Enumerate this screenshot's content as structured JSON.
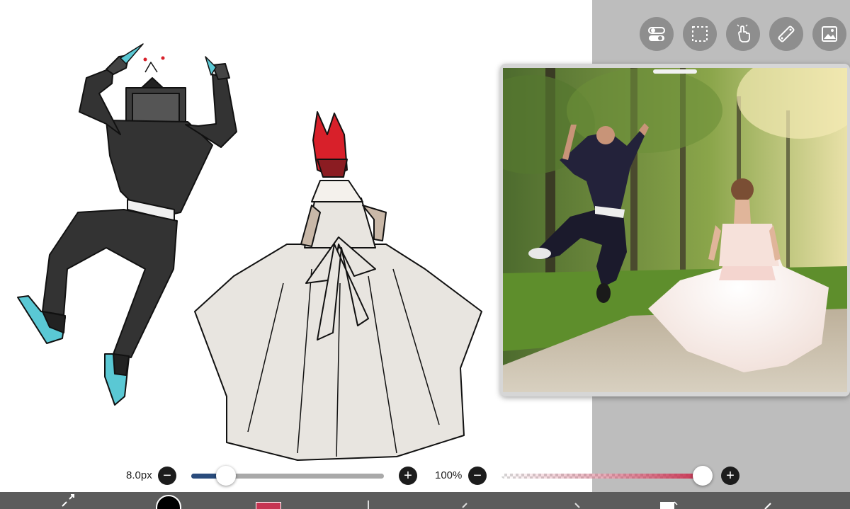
{
  "top_tools": [
    {
      "name": "toggle-icon"
    },
    {
      "name": "selection-icon"
    },
    {
      "name": "hand-gesture-icon"
    },
    {
      "name": "ruler-icon"
    },
    {
      "name": "image-icon"
    }
  ],
  "reference_window": {
    "image": "reference photo: groom jumping, bride running in forest"
  },
  "brush_size": {
    "value_label": "8.0px",
    "fraction": 0.18
  },
  "opacity": {
    "value_label": "100%",
    "fraction": 1.0
  },
  "colors": {
    "accent_blue": "#294b7c",
    "brush_red": "#c63452",
    "toolbar_gray": "#5c5c5c",
    "panel_gray": "#bdbdbd",
    "hair_red": "#d8202a",
    "shoe_teal": "#5ac8d4"
  },
  "bottom_toolbar": [
    {
      "name": "transform-icon"
    },
    {
      "name": "brush-color-icon"
    },
    {
      "name": "color-swatch"
    },
    {
      "name": "layer-divider"
    },
    {
      "name": "undo-icon"
    },
    {
      "name": "redo-icon"
    },
    {
      "name": "layers-icon"
    },
    {
      "name": "check-icon"
    }
  ]
}
